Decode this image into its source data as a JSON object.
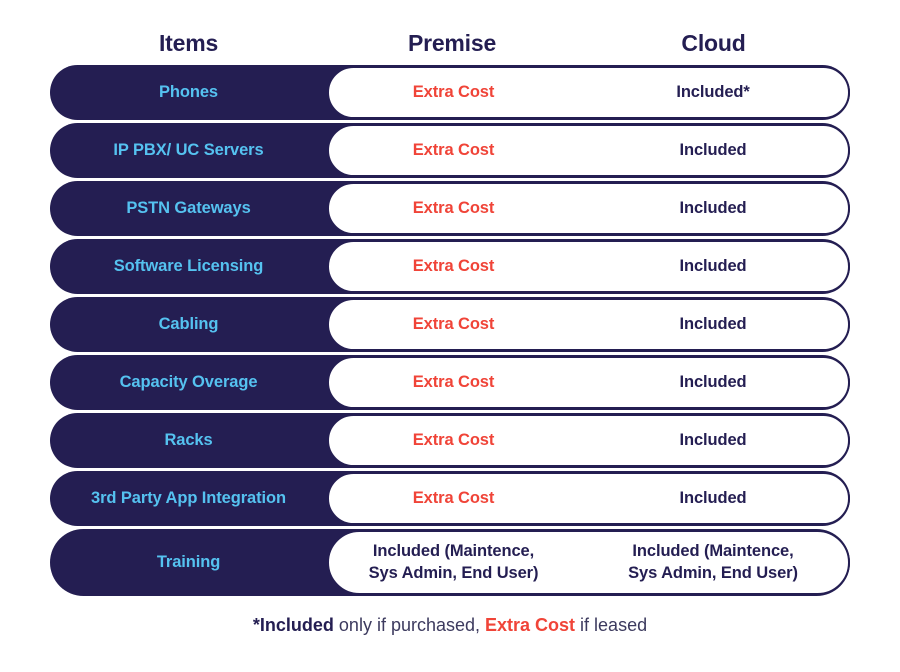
{
  "header": {
    "items_label": "Items",
    "premise_label": "Premise",
    "cloud_label": "Cloud"
  },
  "colors": {
    "navy": "#241E52",
    "light_blue": "#55C2F0",
    "red": "#F04438",
    "white": "#FFFFFF",
    "footnote_text": "#3C3A5E"
  },
  "rows": [
    {
      "item": "Phones",
      "premise": "Extra Cost",
      "cloud": "Included*"
    },
    {
      "item": "IP PBX/ UC Servers",
      "premise": "Extra Cost",
      "cloud": "Included"
    },
    {
      "item": "PSTN Gateways",
      "premise": "Extra Cost",
      "cloud": "Included"
    },
    {
      "item": "Software Licensing",
      "premise": "Extra Cost",
      "cloud": "Included"
    },
    {
      "item": "Cabling",
      "premise": "Extra Cost",
      "cloud": "Included"
    },
    {
      "item": "Capacity Overage",
      "premise": "Extra Cost",
      "cloud": "Included"
    },
    {
      "item": "Racks",
      "premise": "Extra Cost",
      "cloud": "Included"
    },
    {
      "item": "3rd Party App Integration",
      "premise": "Extra Cost",
      "cloud": "Included"
    },
    {
      "item": "Training",
      "premise": "Included (Maintence,\nSys Admin, End User)",
      "cloud": "Included (Maintence,\nSys Admin, End User)"
    }
  ],
  "footnote": {
    "asterisk_included": "*Included",
    "middle": " only if purchased, ",
    "extra_cost": "Extra Cost",
    "tail": " if leased"
  }
}
